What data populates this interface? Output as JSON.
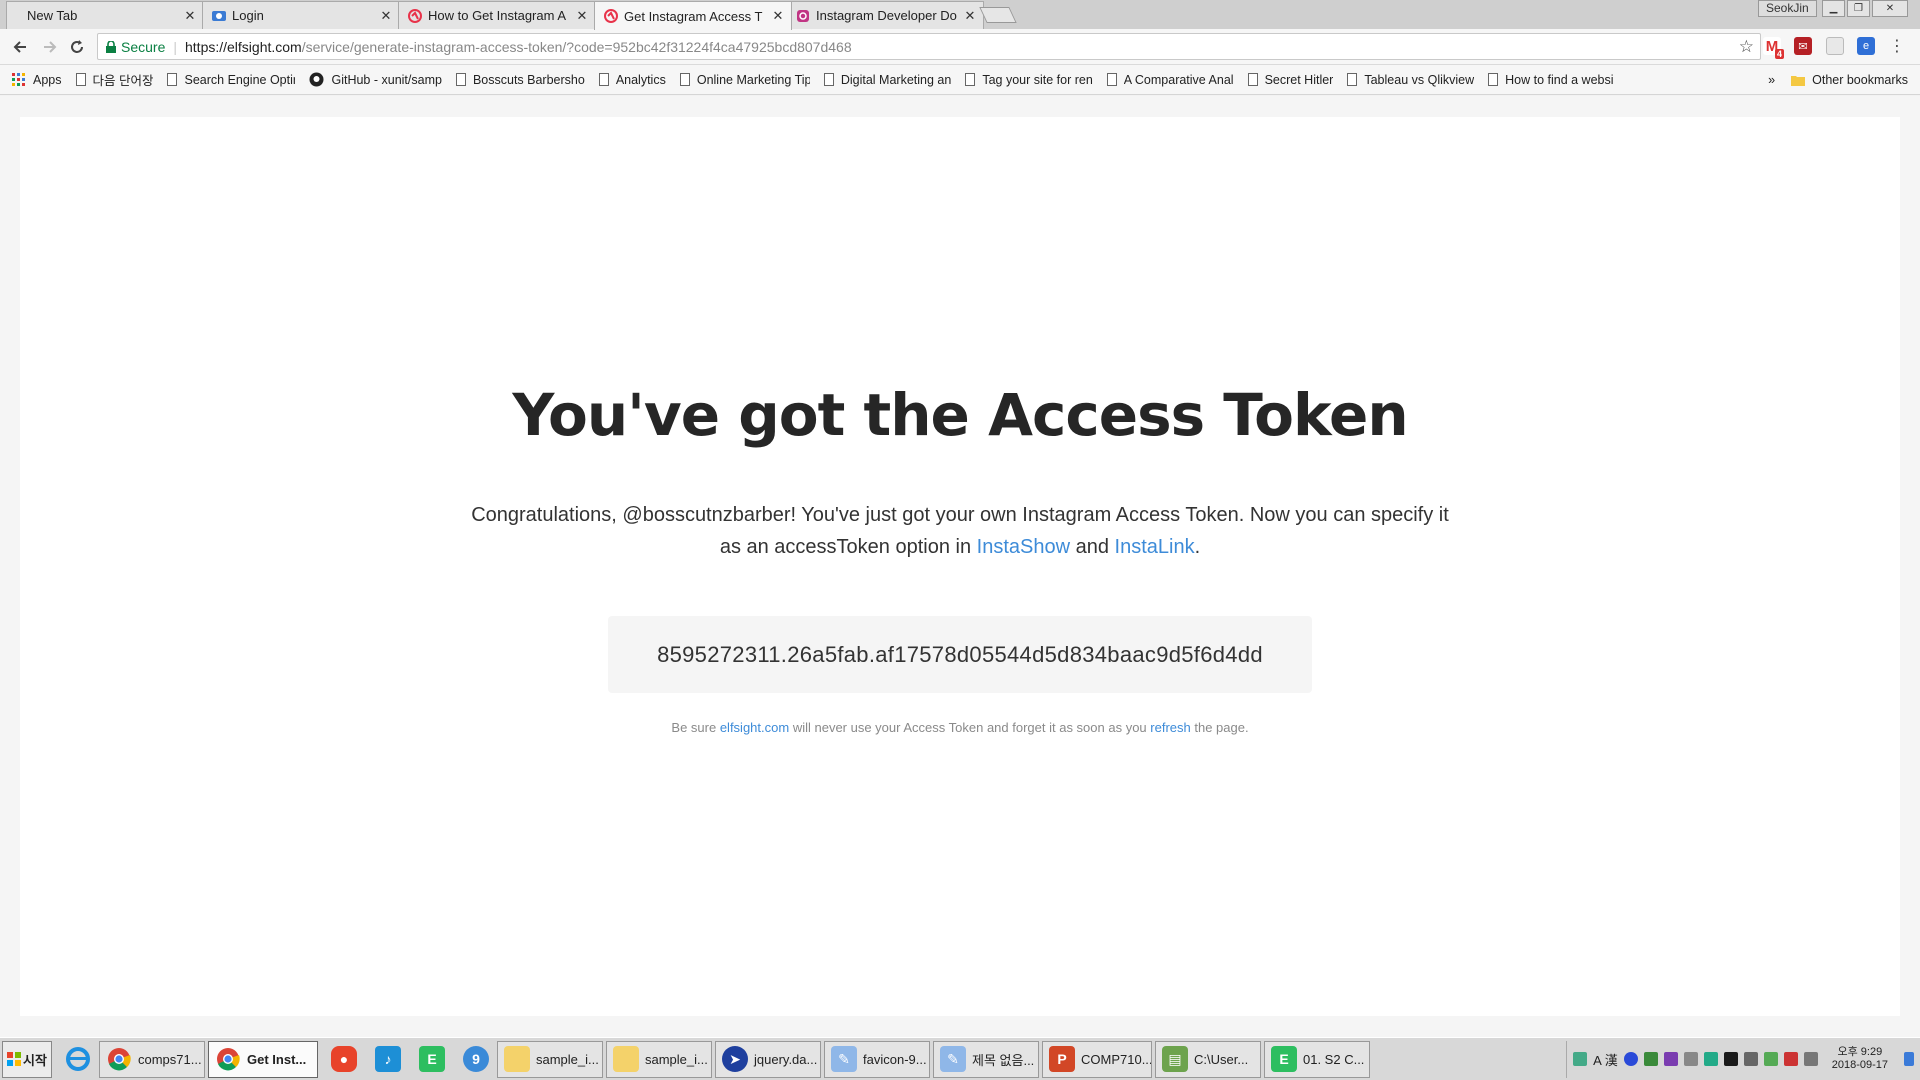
{
  "tabs": [
    {
      "title": "New Tab"
    },
    {
      "title": "Login"
    },
    {
      "title": "How to Get Instagram A"
    },
    {
      "title": "Get Instagram Access T"
    },
    {
      "title": "Instagram Developer Do"
    }
  ],
  "profile_name": "SeokJin",
  "omnibox": {
    "secure_label": "Secure",
    "url_host": "https://elfsight.com",
    "url_rest": "/service/generate-instagram-access-token/?code=952bc42f31224f4ca47925bcd807d468"
  },
  "extensions": {
    "gmail_badge": "4"
  },
  "bookmarks": {
    "apps": "Apps",
    "items": [
      "다음 단어장",
      "Search Engine Optir",
      "GitHub - xunit/samp",
      "Bosscuts Barbersho",
      "Analytics",
      "Online Marketing Tip",
      "Digital Marketing an",
      "Tag your site for ren",
      "A Comparative Anal",
      "Secret Hitler",
      "Tableau vs Qlikview",
      "How to find a websi"
    ],
    "overflow": "»",
    "other": "Other bookmarks"
  },
  "page": {
    "headline": "You've got the Access Token",
    "desc_part1": "Congratulations, @bosscutnzbarber! You've just got your own Instagram Access Token. Now you can specify it as an accessToken option in ",
    "link_instashow": "InstaShow",
    "desc_and": " and ",
    "link_instalink": "InstaLink",
    "desc_end": ".",
    "token": "8595272311.26a5fab.af17578d05544d5d834baac9d5f6d4dd",
    "note_part1": "Be sure ",
    "note_link1": "elfsight.com",
    "note_part2": " will never use your Access Token and forget it as soon as you ",
    "note_link2": "refresh",
    "note_part3": " the page."
  },
  "taskbar": {
    "start_label": "시작",
    "buttons": [
      "comps71...",
      "Get Inst...",
      "sample_i...",
      "sample_i...",
      "jquery.da...",
      "favicon-9...",
      "제목 없음...",
      "COMP710...",
      "C:\\User...",
      "01. S2 C..."
    ],
    "ime": "A 漢",
    "clock_time": "오후 9:29",
    "clock_date": "2018-09-17"
  }
}
